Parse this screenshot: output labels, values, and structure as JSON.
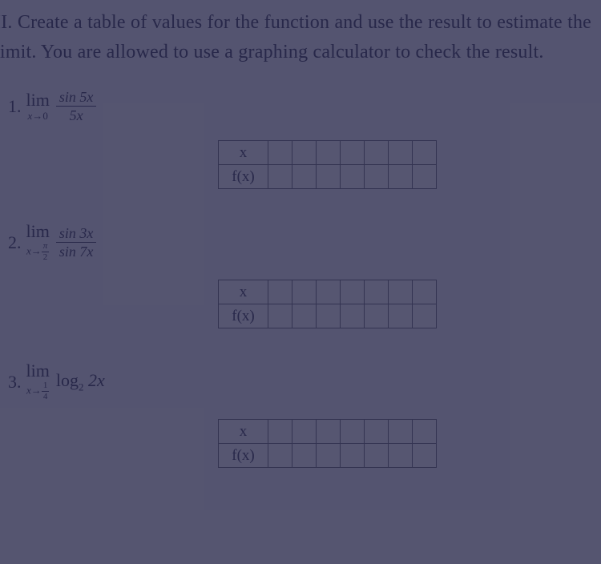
{
  "intro": "II. Create a table of values for the function and use the result to estimate the limit. You are allowed to use a graphing calculator to check the result.",
  "table_labels": {
    "row1": "x",
    "row2": "f(x)"
  },
  "empty_cols": 7,
  "problems": [
    {
      "number": "1.",
      "lim_label": "lim",
      "lim_sub_prefix": "x→",
      "lim_sub_value": "0",
      "frac_num": "sin 5x",
      "frac_den": "5x"
    },
    {
      "number": "2.",
      "lim_label": "lim",
      "lim_sub_prefix": "x→",
      "lim_sub_frac_num": "π",
      "lim_sub_frac_den": "2",
      "frac_num": "sin 3x",
      "frac_den": "sin 7x"
    },
    {
      "number": "3.",
      "lim_label": "lim",
      "lim_sub_prefix": "x→",
      "lim_sub_frac_num": "1",
      "lim_sub_frac_den": "4",
      "expr_log": "log",
      "expr_log_base": "2",
      "expr_arg": " 2x"
    }
  ]
}
